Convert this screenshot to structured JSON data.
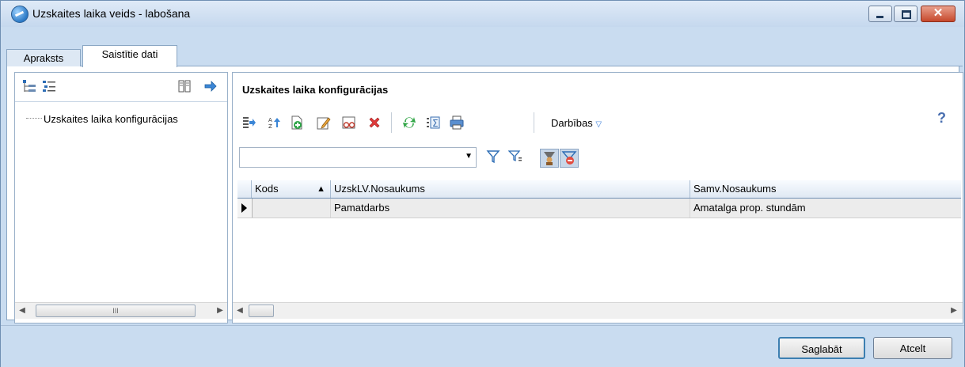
{
  "window": {
    "title": "Uzskaites laika veids - labošana"
  },
  "tabs": [
    {
      "label": "Apraksts"
    },
    {
      "label": "Saistītie dati"
    }
  ],
  "left": {
    "tree_item": "Uzskaites laika konfigurācijas",
    "scroll_thumb": "III"
  },
  "right": {
    "title": "Uzskaites laika konfigurācijas",
    "actions_label": "Darbības",
    "help": "?",
    "filter_value": "",
    "grid": {
      "columns": [
        {
          "label": "Kods"
        },
        {
          "label": "UzskLV.Nosaukums"
        },
        {
          "label": "Samv.Nosaukums"
        }
      ],
      "sort_indicator": "▲",
      "rows": [
        {
          "kods": "",
          "nosaukums": "Pamatdarbs",
          "samv": "Amatalga prop. stundām"
        }
      ]
    }
  },
  "footer": {
    "save": "Saglabāt",
    "cancel": "Atcelt"
  },
  "icons": {
    "app": "globe-icon",
    "toolbar": [
      "tree-expand-icon",
      "list-icon",
      "columns-icon",
      "arrow-right-icon",
      "export-icon",
      "sort-az-icon",
      "add-record-icon",
      "edit-icon",
      "view-icon",
      "delete-icon",
      "refresh-icon",
      "sum-icon",
      "print-icon",
      "filter-icon",
      "filter-advanced-icon",
      "filter-user-icon",
      "filter-clear-icon"
    ]
  },
  "colors": {
    "titlebar": "#c5d8ee",
    "frame": "#c9dcf0",
    "close": "#c6482c",
    "accent": "#3b7fd9"
  }
}
